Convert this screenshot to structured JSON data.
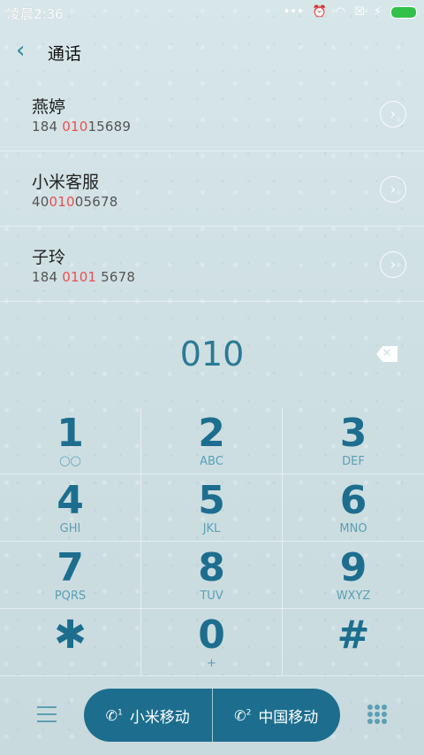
{
  "status": {
    "time": "凌晨2:36"
  },
  "header": {
    "back_icon": "chevron-left-icon",
    "title": "通话"
  },
  "contacts": [
    {
      "name": "燕婷",
      "num_pre": "184 ",
      "num_hl": "010",
      "num_post": "15689"
    },
    {
      "name": "小米客服",
      "num_pre": "40",
      "num_hl": "010",
      "num_post": "05678"
    },
    {
      "name": "子玲",
      "num_pre": "184 ",
      "num_hl": "0101",
      "num_post": " 5678"
    }
  ],
  "dialed": "010",
  "keys": [
    {
      "digit": "1",
      "letters": ""
    },
    {
      "digit": "2",
      "letters": "ABC"
    },
    {
      "digit": "3",
      "letters": "DEF"
    },
    {
      "digit": "4",
      "letters": "GHI"
    },
    {
      "digit": "5",
      "letters": "JKL"
    },
    {
      "digit": "6",
      "letters": "MNO"
    },
    {
      "digit": "7",
      "letters": "PQRS"
    },
    {
      "digit": "8",
      "letters": "TUV"
    },
    {
      "digit": "9",
      "letters": "WXYZ"
    },
    {
      "digit": "✱",
      "letters": ""
    },
    {
      "digit": "0",
      "letters": "+"
    },
    {
      "digit": "#",
      "letters": ""
    }
  ],
  "calls": [
    {
      "sim": "1",
      "label": "小米移动"
    },
    {
      "sim": "2",
      "label": "中国移动"
    }
  ],
  "colors": {
    "accent": "#1d6e8e",
    "highlight": "#e85050"
  }
}
